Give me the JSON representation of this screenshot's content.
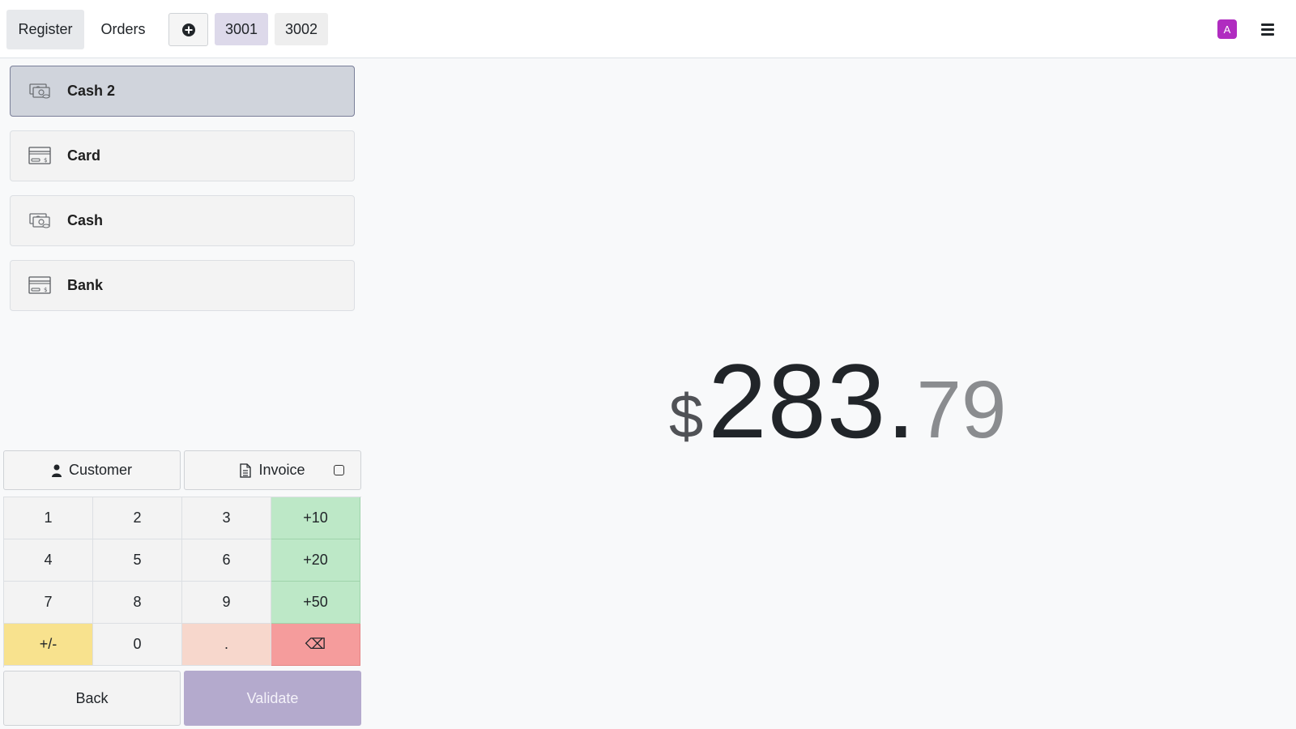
{
  "topbar": {
    "register_label": "Register",
    "orders_label": "Orders",
    "order_tabs": [
      "3001",
      "3002"
    ],
    "avatar_letter": "A"
  },
  "payment_methods": [
    {
      "label": "Cash 2",
      "icon": "cash-icon",
      "selected": true
    },
    {
      "label": "Card",
      "icon": "card-icon",
      "selected": false
    },
    {
      "label": "Cash",
      "icon": "cash-icon",
      "selected": false
    },
    {
      "label": "Bank",
      "icon": "card-icon",
      "selected": false
    }
  ],
  "amount": {
    "currency": "$",
    "integer": "283.",
    "decimal": "79"
  },
  "actions": {
    "customer_label": "Customer",
    "invoice_label": "Invoice"
  },
  "numpad": {
    "keys": [
      "1",
      "2",
      "3",
      "+10",
      "4",
      "5",
      "6",
      "+20",
      "7",
      "8",
      "9",
      "+50",
      "+/-",
      "0",
      ".",
      "⌫"
    ]
  },
  "footer": {
    "back_label": "Back",
    "validate_label": "Validate"
  },
  "colors": {
    "accent": "#b4aacd",
    "avatar": "#b02cc0",
    "quick_add": "#bde8c7",
    "sign": "#f8e28e",
    "decimal": "#f7d7cc",
    "backspace": "#f59c9c"
  }
}
